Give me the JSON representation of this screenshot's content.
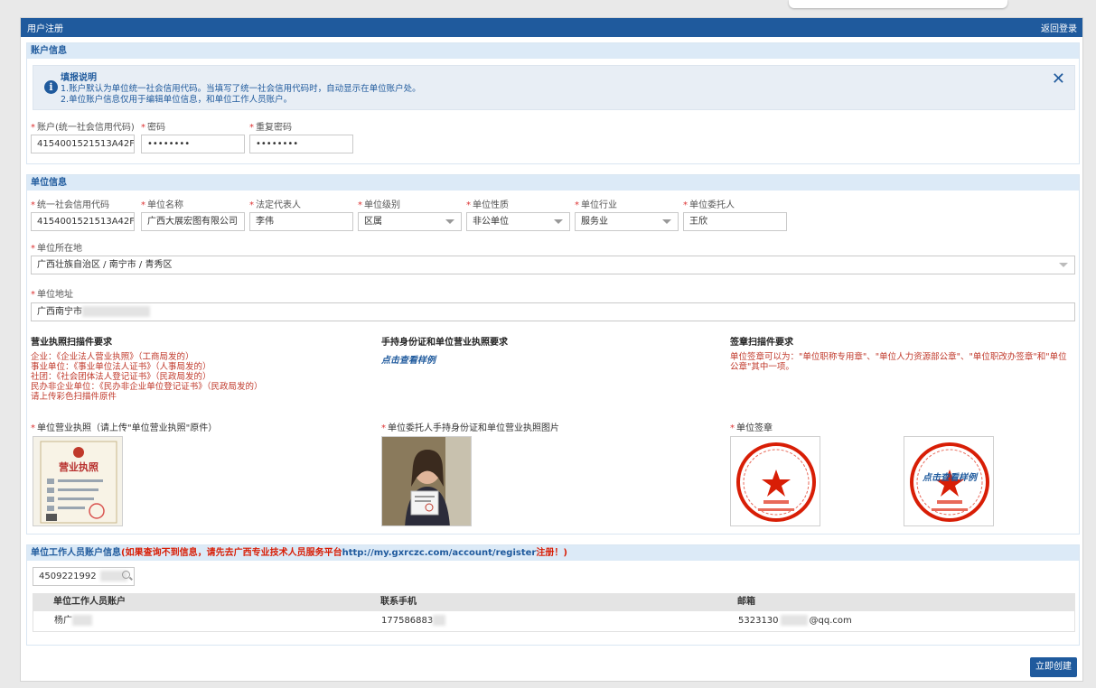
{
  "window": {
    "title": "用户注册",
    "back_label": "返回登录"
  },
  "account": {
    "header": "账户信息",
    "notice": {
      "title": "填报说明",
      "line1": "1.账户默认为单位统一社会信用代码。当填写了统一社会信用代码时，自动显示在单位账户处。",
      "line2": "2.单位账户信息仅用于编辑单位信息，和单位工作人员账户。"
    },
    "fields": {
      "account_label": "账户(统一社会信用代码)",
      "account_value": "4154001521513A42F",
      "password_label": "密码",
      "password_value": "••••••••",
      "repeat_label": "重复密码",
      "repeat_value": "••••••••"
    }
  },
  "unit": {
    "header": "单位信息",
    "fields": {
      "credit_label": "统一社会信用代码",
      "credit_value": "4154001521513A42F",
      "name_label": "单位名称",
      "name_value": "广西大展宏图有限公司",
      "legal_label": "法定代表人",
      "legal_value": "李伟",
      "level_label": "单位级别",
      "level_value": "区属",
      "nature_label": "单位性质",
      "nature_value": "非公单位",
      "industry_label": "单位行业",
      "industry_value": "服务业",
      "agent_label": "单位委托人",
      "agent_value": "王欣",
      "location_label": "单位所在地",
      "location_value": "广西壮族自治区 / 南宁市 / 青秀区",
      "address_label": "单位地址",
      "address_value": "广西南宁市"
    },
    "requirements": {
      "license_title": "营业执照扫描件要求",
      "license_text": "企业：《企业法人营业执照》（工商局发的）\n事业单位：《事业单位法人证书》（人事局发的）\n社团：《社会团体法人登记证书》（民政局发的）\n民办非企业单位：《民办非企业单位登记证书》（民政局发的）\n请上传彩色扫描件原件",
      "idcard_title": "手持身份证和单位营业执照要求",
      "idcard_link": "点击查看样例",
      "seal_title": "签章扫描件要求",
      "seal_text": "单位签章可以为：\"单位职称专用章\"、\"单位人力资源部公章\"、\"单位职改办签章\"和\"单位公章\"其中一项。"
    },
    "uploads": {
      "license_label": "单位营业执照（请上传\"单位营业执照\"原件）",
      "license_img": "营业执照",
      "idcard_label": "单位委托人手持身份证和单位营业执照图片",
      "seal_label": "单位签章",
      "seal_sample_label": "点击查看样例"
    }
  },
  "staff": {
    "header_prefix": "单位工作人员账户信息",
    "header_note": "(如果查询不到信息，请先去广西专业技术人员服务平台",
    "header_url": "http://my.gxrczc.com/account/register",
    "header_suffix": "注册！)",
    "search_value": "4509221992",
    "columns": [
      "单位工作人员账户",
      "联系手机",
      "邮箱"
    ],
    "rows": [
      {
        "account": "杨广",
        "phone": "177586883",
        "email_prefix": "5323130",
        "email_suffix": "@qq.com"
      }
    ]
  },
  "actions": {
    "create_label": "立即创建"
  },
  "colors": {
    "primary": "#1f5a9d",
    "required": "#d33",
    "note_red": "#d81e06"
  }
}
